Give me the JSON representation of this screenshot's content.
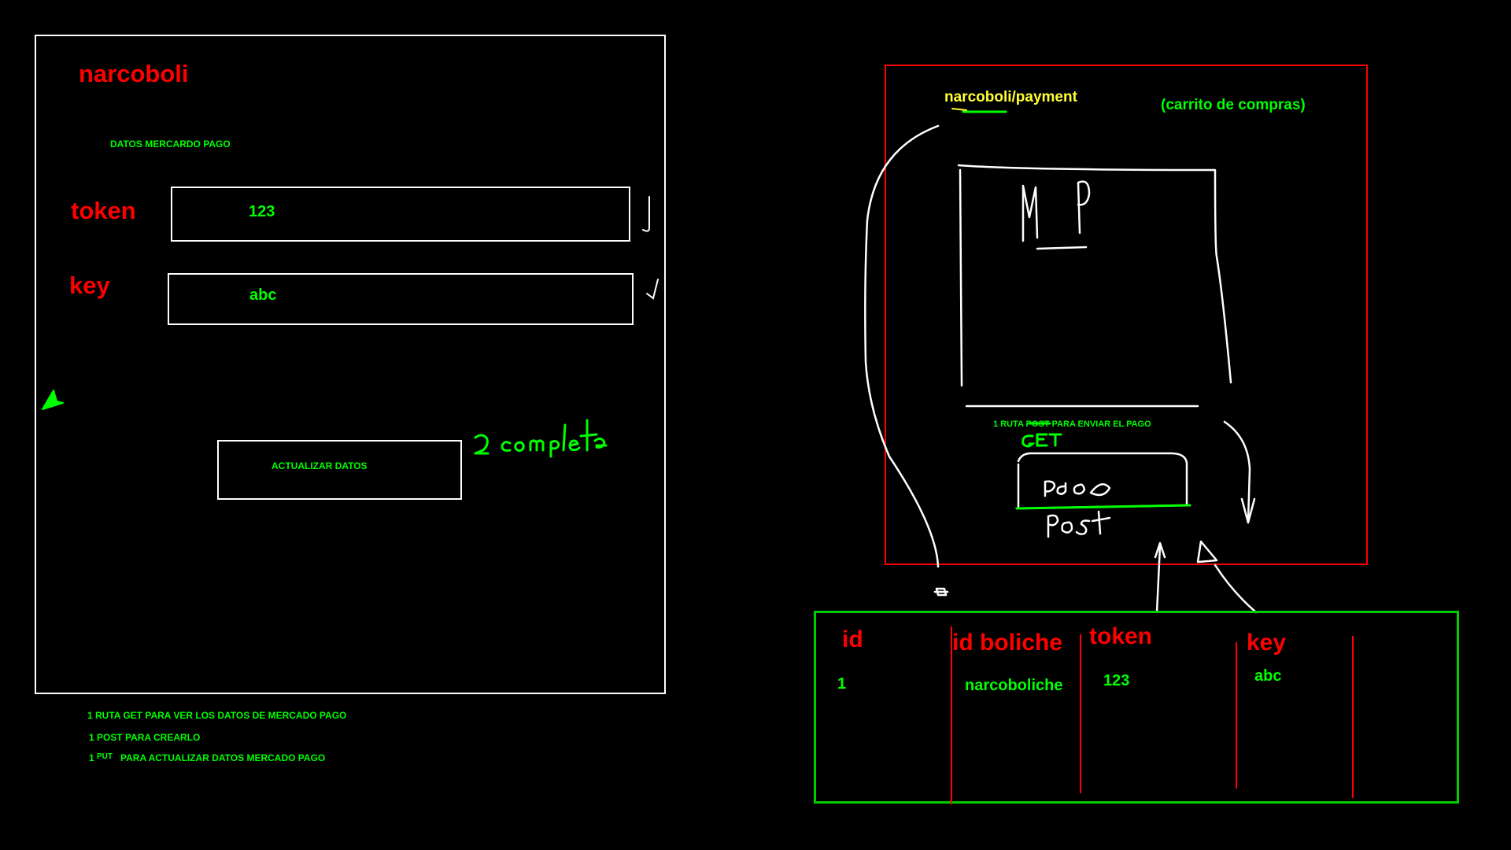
{
  "left_panel": {
    "title": "narcoboli",
    "section_label": "DATOS MERCARDO PAGO",
    "token_label": "token",
    "token_value": "123",
    "key_label": "key",
    "key_value": "abc",
    "update_button_label": "ACTUALIZAR DATOS",
    "handwritten_note": "2 completos"
  },
  "notes": {
    "line1": "1 RUTA GET PARA VER LOS DATOS DE MERCADO PAGO",
    "line2": "1 POST PARA CREARLO",
    "line3_prefix": "1 ",
    "line3_tag": "PUT",
    "line3_rest": "PARA ACTUALIZAR DATOS MERCADO PAGO"
  },
  "payment_panel": {
    "route_title": "narcoboli/payment",
    "subtitle": "(carrito de compras)",
    "mp_sketch": "MP",
    "route_note": "1 RUTA POST PARA ENVIAR EL PAGO",
    "handwritten_get": "GET",
    "pay_button_sketch": "pago",
    "handwritten_post": "post"
  },
  "db_table": {
    "headers": [
      "id",
      "id boliche",
      "token",
      "key"
    ],
    "row": [
      "1",
      "narcoboliche",
      "123",
      "abc"
    ]
  },
  "colors": {
    "background": "#000000",
    "label_red": "#ff0000",
    "value_green": "#00ff00",
    "route_yellow": "#ffff33",
    "stroke_white": "#ffffff"
  }
}
